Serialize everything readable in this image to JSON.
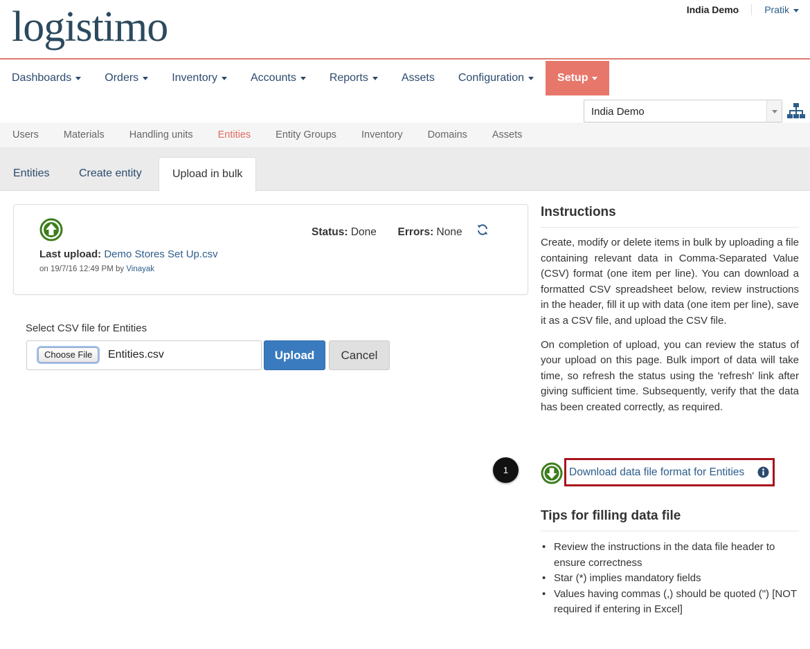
{
  "header": {
    "logo_text": "logistimo",
    "domain_name": "India Demo",
    "user_name": "Pratik"
  },
  "main_nav": [
    {
      "label": "Dashboards",
      "dropdown": true
    },
    {
      "label": "Orders",
      "dropdown": true
    },
    {
      "label": "Inventory",
      "dropdown": true
    },
    {
      "label": "Accounts",
      "dropdown": true
    },
    {
      "label": "Reports",
      "dropdown": true
    },
    {
      "label": "Assets",
      "dropdown": false
    },
    {
      "label": "Configuration",
      "dropdown": true
    },
    {
      "label": "Setup",
      "dropdown": true,
      "active": true
    }
  ],
  "domain_select": {
    "value": "India Demo"
  },
  "sub_nav": [
    "Users",
    "Materials",
    "Handling units",
    "Entities",
    "Entity Groups",
    "Inventory",
    "Domains",
    "Assets"
  ],
  "sub_nav_active": "Entities",
  "tabs": [
    "Entities",
    "Create entity",
    "Upload in bulk"
  ],
  "tab_active": "Upload in bulk",
  "upload_status": {
    "last_upload_label": "Last upload:",
    "last_upload_file": "Demo Stores Set Up.csv",
    "meta_prefix": "on 19/7/16 12:49 PM by",
    "meta_user": "Vinayak",
    "status_label": "Status:",
    "status_value": "Done",
    "errors_label": "Errors:",
    "errors_value": "None"
  },
  "file_upload": {
    "label": "Select CSV file for Entities",
    "choose_button": "Choose File",
    "file_name": "Entities.csv",
    "upload_button": "Upload",
    "cancel_button": "Cancel"
  },
  "instructions": {
    "title": "Instructions",
    "para1": "Create, modify or delete items in bulk by uploading a file containing relevant data in Comma-Separated Value (CSV) format (one item per line). You can download a formatted CSV spreadsheet below, review instructions in the header, fill it up with data (one item per line), save it as a CSV file, and upload the CSV file.",
    "para2": "On completion of upload, you can review the status of your upload on this page. Bulk import of data will take time, so refresh the status using the 'refresh' link after giving sufficient time. Subsequently, verify that the data has been created correctly, as required.",
    "download_link": "Download data file format for Entities",
    "step_badge": "1"
  },
  "tips": {
    "title": "Tips for filling data file",
    "items": [
      "Review the instructions in the data file header to ensure correctness",
      "Star (*) implies mandatory fields",
      "Values having commas (,) should be quoted (\") [NOT required if entering in Excel]"
    ]
  },
  "colors": {
    "accent": "#e8776b",
    "link": "#2c5d8a",
    "green_icon": "#3d7d1c",
    "highlight_box": "#a8141c"
  }
}
